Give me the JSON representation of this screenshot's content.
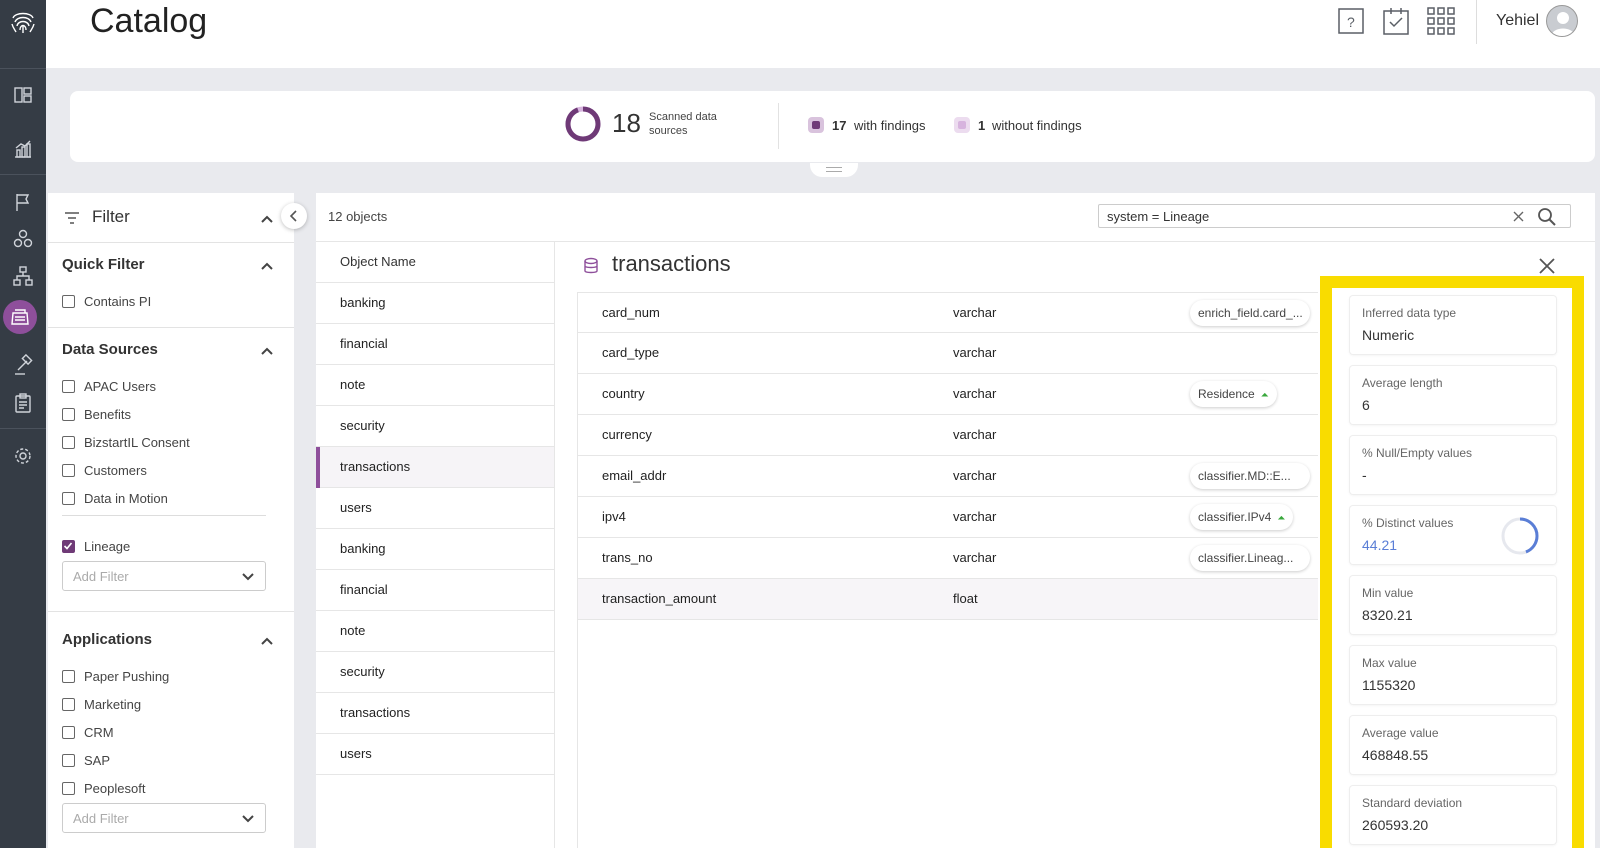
{
  "header": {
    "title": "Catalog",
    "user_name": "Yehiel",
    "icons": [
      "help-icon",
      "tasks-icon",
      "apps-grid-icon",
      "avatar-icon"
    ]
  },
  "summary": {
    "scanned_count": "18",
    "scanned_label": "Scanned data sources",
    "with_findings_count": "17",
    "with_findings_label": "with findings",
    "without_findings_count": "1",
    "without_findings_label": "without findings",
    "colors": {
      "with": "#6f3a77",
      "without": "#d7b4de"
    }
  },
  "filter": {
    "title": "Filter",
    "quick_filter": {
      "title": "Quick Filter",
      "items": [
        {
          "label": "Contains PI",
          "checked": false
        }
      ]
    },
    "data_sources": {
      "title": "Data Sources",
      "items": [
        {
          "label": "APAC Users",
          "checked": false
        },
        {
          "label": "Benefits",
          "checked": false
        },
        {
          "label": "BizstartIL Consent",
          "checked": false
        },
        {
          "label": "Customers",
          "checked": false
        },
        {
          "label": "Data in Motion",
          "checked": false
        }
      ],
      "selected": [
        {
          "label": "Lineage",
          "checked": true
        }
      ],
      "add_filter_placeholder": "Add Filter"
    },
    "applications": {
      "title": "Applications",
      "items": [
        {
          "label": "Paper Pushing",
          "checked": false
        },
        {
          "label": "Marketing",
          "checked": false
        },
        {
          "label": "CRM",
          "checked": false
        },
        {
          "label": "SAP",
          "checked": false
        },
        {
          "label": "Peoplesoft",
          "checked": false
        }
      ],
      "add_filter_placeholder": "Add Filter"
    }
  },
  "main": {
    "object_count": "12 objects",
    "search_value": "system = Lineage",
    "object_list_header": "Object Name",
    "objects": [
      "banking",
      "financial",
      "note",
      "security",
      "transactions",
      "users",
      "banking",
      "financial",
      "note",
      "security",
      "transactions",
      "users"
    ],
    "selected_index": 4,
    "detail": {
      "title": "transactions",
      "columns": [
        {
          "name": "card_num",
          "type": "varchar",
          "tag": "enrich_field.card_...",
          "tag_arrow": false
        },
        {
          "name": "card_type",
          "type": "varchar",
          "tag": "",
          "tag_arrow": false
        },
        {
          "name": "country",
          "type": "varchar",
          "tag": "Residence",
          "tag_arrow": true
        },
        {
          "name": "currency",
          "type": "varchar",
          "tag": "",
          "tag_arrow": false
        },
        {
          "name": "email_addr",
          "type": "varchar",
          "tag": "classifier.MD::E...",
          "tag_arrow": false
        },
        {
          "name": "ipv4",
          "type": "varchar",
          "tag": "classifier.IPv4",
          "tag_arrow": true
        },
        {
          "name": "trans_no",
          "type": "varchar",
          "tag": "classifier.Lineag...",
          "tag_arrow": false
        },
        {
          "name": "transaction_amount",
          "type": "float",
          "tag": "",
          "tag_arrow": false
        }
      ],
      "highlighted_row": 7
    }
  },
  "stats": {
    "highlight_color": "#f9dc00",
    "items": [
      {
        "label": "Inferred data type",
        "value": "Numeric"
      },
      {
        "label": "Average length",
        "value": "6"
      },
      {
        "label": "% Null/Empty values",
        "value": "-"
      },
      {
        "label": "% Distinct values",
        "value": "44.21",
        "gauge_fraction": 0.4421
      },
      {
        "label": "Min value",
        "value": "8320.21"
      },
      {
        "label": "Max value",
        "value": "1155320"
      },
      {
        "label": "Average value",
        "value": "468848.55"
      },
      {
        "label": "Standard deviation",
        "value": "260593.20"
      }
    ]
  }
}
